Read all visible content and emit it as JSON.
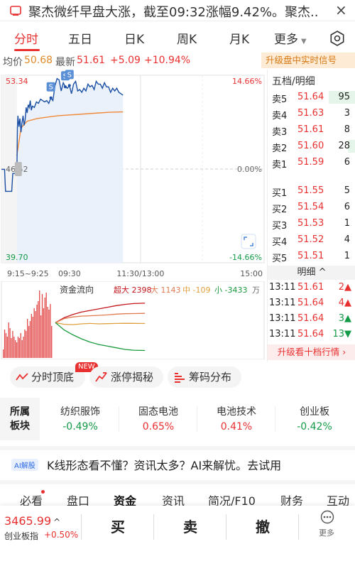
{
  "news": {
    "icon": "news-icon",
    "text": "聚杰微纤早盘大涨，截至09:32涨幅9.42%。聚杰...",
    "close": "×"
  },
  "tabs": [
    "分时",
    "五日",
    "日K",
    "周K",
    "月K",
    "更多"
  ],
  "active_tab": "分时",
  "quote": {
    "avg_label": "均价",
    "avg_value": "50.68",
    "last_label": "最新",
    "last_value": "51.61",
    "change": "+5.09",
    "pct": "+10.94%"
  },
  "upgrade_signal": "升级盘中实时信号",
  "colors": {
    "up": "#e93030",
    "down": "#139a48",
    "price_line": "#1a4fa3",
    "avg_line": "#f08a3a",
    "accent": "#e93030"
  },
  "chart_data": [
    {
      "type": "line",
      "title": "",
      "x_ticks": [
        "9:15~9:25",
        "09:30",
        "11:30/13:00",
        "15:00"
      ],
      "y_left_ticks": [
        "53.34",
        "46.52",
        "39.70"
      ],
      "y_right_ticks": [
        "14.66%",
        "0.00%",
        "-14.66%"
      ],
      "ylim": [
        39.7,
        53.34
      ],
      "prev_close": 46.52,
      "series": [
        {
          "kind": "price",
          "x": [
            -15,
            -12,
            -11,
            -5,
            -4,
            0,
            0.5,
            1,
            2,
            3,
            4,
            5,
            6,
            7,
            8,
            9,
            10,
            11,
            12,
            13,
            14,
            15,
            17,
            19,
            21,
            23,
            25,
            27,
            29,
            31,
            33,
            35,
            37,
            39,
            41,
            43,
            45,
            47,
            49,
            51,
            53,
            55,
            57,
            59,
            61,
            63,
            65,
            67,
            69,
            71,
            73,
            75,
            77,
            79,
            81,
            83,
            85,
            87,
            89,
            91,
            93,
            95,
            97,
            99,
            101,
            103
          ],
          "y": [
            46.5,
            46.5,
            44.9,
            44.9,
            46.2,
            46.2,
            49.5,
            50.4,
            49.6,
            50.2,
            49.2,
            49.9,
            50.4,
            49.7,
            50.1,
            51.0,
            50.6,
            51.2,
            51.0,
            51.5,
            50.8,
            51.1,
            51.0,
            51.4,
            51.3,
            51.6,
            51.5,
            51.4,
            51.5,
            51.3,
            51.7,
            51.5,
            52.6,
            53.1,
            53.0,
            52.2,
            52.8,
            52.5,
            52.4,
            52.6,
            52.0,
            52.7,
            52.9,
            52.2,
            52.3,
            52.1,
            52.4,
            52.2,
            52.7,
            52.5,
            52.6,
            52.3,
            52.9,
            52.7,
            52.7,
            52.4,
            52.8,
            52.5,
            52.5,
            52.1,
            52.4,
            52.2,
            52.4,
            52.1,
            52.0,
            51.9
          ]
        },
        {
          "kind": "avg",
          "x": [
            0,
            4,
            10,
            20,
            30,
            40,
            50,
            60,
            70,
            80,
            90,
            103
          ],
          "y": [
            47.5,
            49.5,
            50.0,
            50.2,
            50.3,
            50.4,
            50.45,
            50.5,
            50.55,
            50.6,
            50.65,
            50.68
          ]
        }
      ],
      "markers": [
        {
          "x": 33,
          "label": "S"
        },
        {
          "x": 47,
          "label": "S"
        },
        {
          "x": 51,
          "label": "S"
        }
      ]
    },
    {
      "type": "line",
      "title": "资金流向",
      "legend": [
        {
          "label": "超大",
          "value": "2398",
          "color": "#c4161c"
        },
        {
          "label": "大",
          "value": "1143",
          "color": "#e07a4f"
        },
        {
          "label": "中",
          "value": "-109",
          "color": "#e0a040"
        },
        {
          "label": "小",
          "value": "-3433",
          "color": "#1a9a3d"
        }
      ],
      "unit": "万",
      "volume_bars": [
        0.12,
        0.4,
        0.35,
        0.3,
        0.5,
        0.42,
        0.28,
        0.38,
        0.3,
        0.25,
        0.22,
        0.3,
        0.28,
        0.35,
        0.25,
        0.3,
        0.4,
        0.38,
        0.55,
        0.45,
        0.52,
        0.62,
        0.58,
        0.7,
        0.66,
        0.75,
        0.8,
        0.95,
        0.6,
        0.9,
        0.7,
        0.85,
        0.92,
        0.72,
        0.68,
        0.76,
        0.45
      ],
      "series": [
        {
          "name": "超大",
          "x": [
            0,
            10,
            20,
            30,
            40,
            50,
            60,
            70,
            80,
            90,
            103
          ],
          "y": [
            0,
            600,
            1000,
            1300,
            1500,
            1700,
            1900,
            2100,
            2250,
            2350,
            2398
          ]
        },
        {
          "name": "大",
          "x": [
            0,
            10,
            20,
            30,
            40,
            50,
            60,
            70,
            80,
            90,
            103
          ],
          "y": [
            0,
            500,
            700,
            800,
            850,
            900,
            950,
            1050,
            1100,
            1120,
            1143
          ]
        },
        {
          "name": "中",
          "x": [
            0,
            10,
            20,
            30,
            40,
            50,
            60,
            70,
            80,
            90,
            103
          ],
          "y": [
            0,
            -200,
            -250,
            -150,
            -100,
            -150,
            -120,
            -100,
            -80,
            -90,
            -109
          ]
        },
        {
          "name": "小",
          "x": [
            0,
            10,
            20,
            30,
            40,
            50,
            60,
            70,
            80,
            90,
            103
          ],
          "y": [
            0,
            -900,
            -1500,
            -2000,
            -2400,
            -2700,
            -2900,
            -3100,
            -3300,
            -3400,
            -3433
          ]
        }
      ]
    }
  ],
  "order_book": {
    "header": "五档/明细",
    "asks": [
      {
        "label": "卖5",
        "price": "51.64",
        "vol": "95",
        "bar": 0.95
      },
      {
        "label": "卖4",
        "price": "51.63",
        "vol": "3",
        "bar": 0
      },
      {
        "label": "卖3",
        "price": "51.61",
        "vol": "8",
        "bar": 0
      },
      {
        "label": "卖2",
        "price": "51.60",
        "vol": "28",
        "bar": 0.28
      },
      {
        "label": "卖1",
        "price": "51.59",
        "vol": "6",
        "bar": 0
      }
    ],
    "bids": [
      {
        "label": "买1",
        "price": "51.55",
        "vol": "5"
      },
      {
        "label": "买2",
        "price": "51.54",
        "vol": "6"
      },
      {
        "label": "买3",
        "price": "51.53",
        "vol": "1"
      },
      {
        "label": "买4",
        "price": "51.52",
        "vol": "4"
      },
      {
        "label": "买5",
        "price": "51.51",
        "vol": "1"
      }
    ],
    "detail_label": "明细 ^",
    "ticks": [
      {
        "time": "13:11",
        "price": "51.61",
        "vol": "2▲",
        "dir": "up"
      },
      {
        "time": "13:11",
        "price": "51.64",
        "vol": "4▲",
        "dir": "up"
      },
      {
        "time": "13:11",
        "price": "51.64",
        "vol": "3▲",
        "dir": "down"
      },
      {
        "time": "13:11",
        "price": "51.64",
        "vol": "13▼",
        "dir": "down"
      }
    ],
    "upgrade": "升级看十档行情 ›"
  },
  "tools": [
    {
      "label": "分时顶底",
      "icon": "trend-icon"
    },
    {
      "label": "涨停揭秘",
      "icon": "limit-up-icon"
    },
    {
      "label": "筹码分布",
      "icon": "chip-distribution-icon"
    }
  ],
  "new_badge": "NEW",
  "sectors": {
    "label": "所属板块",
    "items": [
      {
        "name": "纺织服饰",
        "pct": "-0.49%",
        "dir": "down"
      },
      {
        "name": "固态电池",
        "pct": "0.65%",
        "dir": "up"
      },
      {
        "name": "电池技术",
        "pct": "0.41%",
        "dir": "up"
      },
      {
        "name": "创业板",
        "pct": "-0.42%",
        "dir": "down"
      }
    ]
  },
  "ai": {
    "badge": "AI解股",
    "text": "K线形态看不懂？资讯太多？AI来解忧。去试用"
  },
  "bottom_tabs": [
    "必看",
    "盘口",
    "资金",
    "资讯",
    "简况/F10",
    "财务",
    "互动"
  ],
  "active_bottom_tab": "资金",
  "index": {
    "value": "3465.99",
    "arrow": "^",
    "name": "创业板指",
    "change": "+0.50%"
  },
  "trade": {
    "buy": "买",
    "sell": "卖",
    "cancel": "撤",
    "more": "更多"
  }
}
